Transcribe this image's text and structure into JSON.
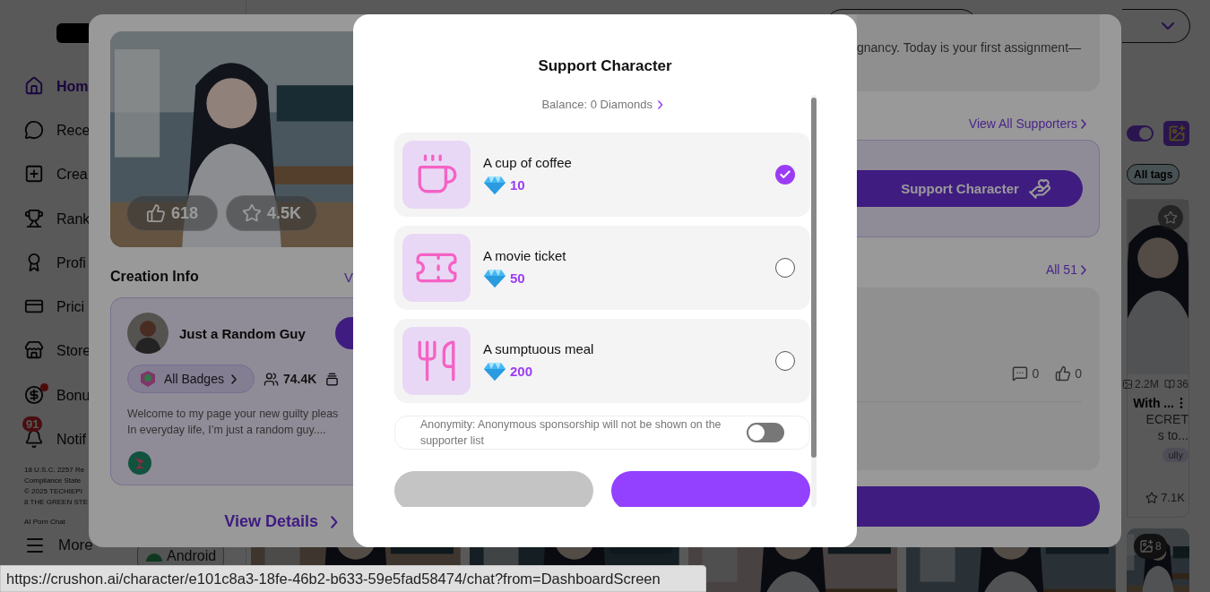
{
  "sidebar": {
    "items": [
      {
        "kind": "home",
        "label": "Hom",
        "selected": true,
        "dot": false
      },
      {
        "kind": "chat",
        "label": "Rece",
        "selected": false,
        "dot": false
      },
      {
        "kind": "create",
        "label": "Crea",
        "selected": false,
        "dot": false
      },
      {
        "kind": "trophy",
        "label": "Rank",
        "selected": false,
        "dot": false
      },
      {
        "kind": "profile",
        "label": "Profi",
        "selected": false,
        "dot": false
      },
      {
        "kind": "pricing",
        "label": "Prici",
        "selected": false,
        "dot": false
      },
      {
        "kind": "store",
        "label": "Store",
        "selected": false,
        "dot": false
      },
      {
        "kind": "bonus",
        "label": "Bonu",
        "selected": false,
        "dot": true
      },
      {
        "kind": "bell",
        "label": "Notif",
        "selected": false,
        "dot": false,
        "badge": "91"
      }
    ],
    "footer_lines": [
      "18 U.S.C. 2257 Re",
      "Compliance State",
      "© 2025 TECHIEPI",
      "8 THE GREEN STE"
    ],
    "footer_link": "AI Porn Chat",
    "more": "More",
    "download": "Android"
  },
  "character": {
    "stats": [
      {
        "kind": "like",
        "value": "618"
      },
      {
        "kind": "star",
        "value": "4.5K"
      }
    ],
    "section_title": "Creation Info",
    "section_link": "V",
    "creator": {
      "name": "Just a Random Guy",
      "badges": "All Badges",
      "followers": "74.4K",
      "bio": [
        "Welcome to my page your new guilty pleas",
        "In everyday life, I’m just a random guy...."
      ]
    },
    "view_details": "View Details",
    "intro": "gnancy. Today is your first assignment—",
    "supporters_link": "View All Supporters",
    "support_button": "Support Character",
    "comments_link": "All 51",
    "counts": [
      {
        "kind": "comment",
        "value": "0"
      },
      {
        "kind": "like",
        "value": "0"
      }
    ]
  },
  "rail": {
    "filter_toggle": {
      "on": true
    },
    "all_tags": "All tags",
    "card": {
      "views": "2.2M",
      "chapters": "36",
      "title": "With ...",
      "lines": [
        "ECRET",
        "s to..."
      ],
      "tag": "ully",
      "stars": "7.1K"
    },
    "second_card": {
      "badge": "8"
    }
  },
  "modal": {
    "title": "Support Character",
    "balance": "Balance: 0 Diamonds",
    "gifts": [
      {
        "kind": "coffee",
        "name": "A cup of coffee",
        "price": "10",
        "selected": true
      },
      {
        "kind": "ticket",
        "name": "A movie ticket",
        "price": "50",
        "selected": false
      },
      {
        "kind": "meal",
        "name": "A sumptuous meal",
        "price": "200",
        "selected": false
      }
    ],
    "anonymity": {
      "label": "Anonymity: Anonymous sponsorship will not be shown on the supporter list",
      "on": false
    }
  },
  "status_url": "https://crushon.ai/character/e101c8a3-18fe-46b2-b633-59e5fad58474/chat?from=DashboardScreen"
}
